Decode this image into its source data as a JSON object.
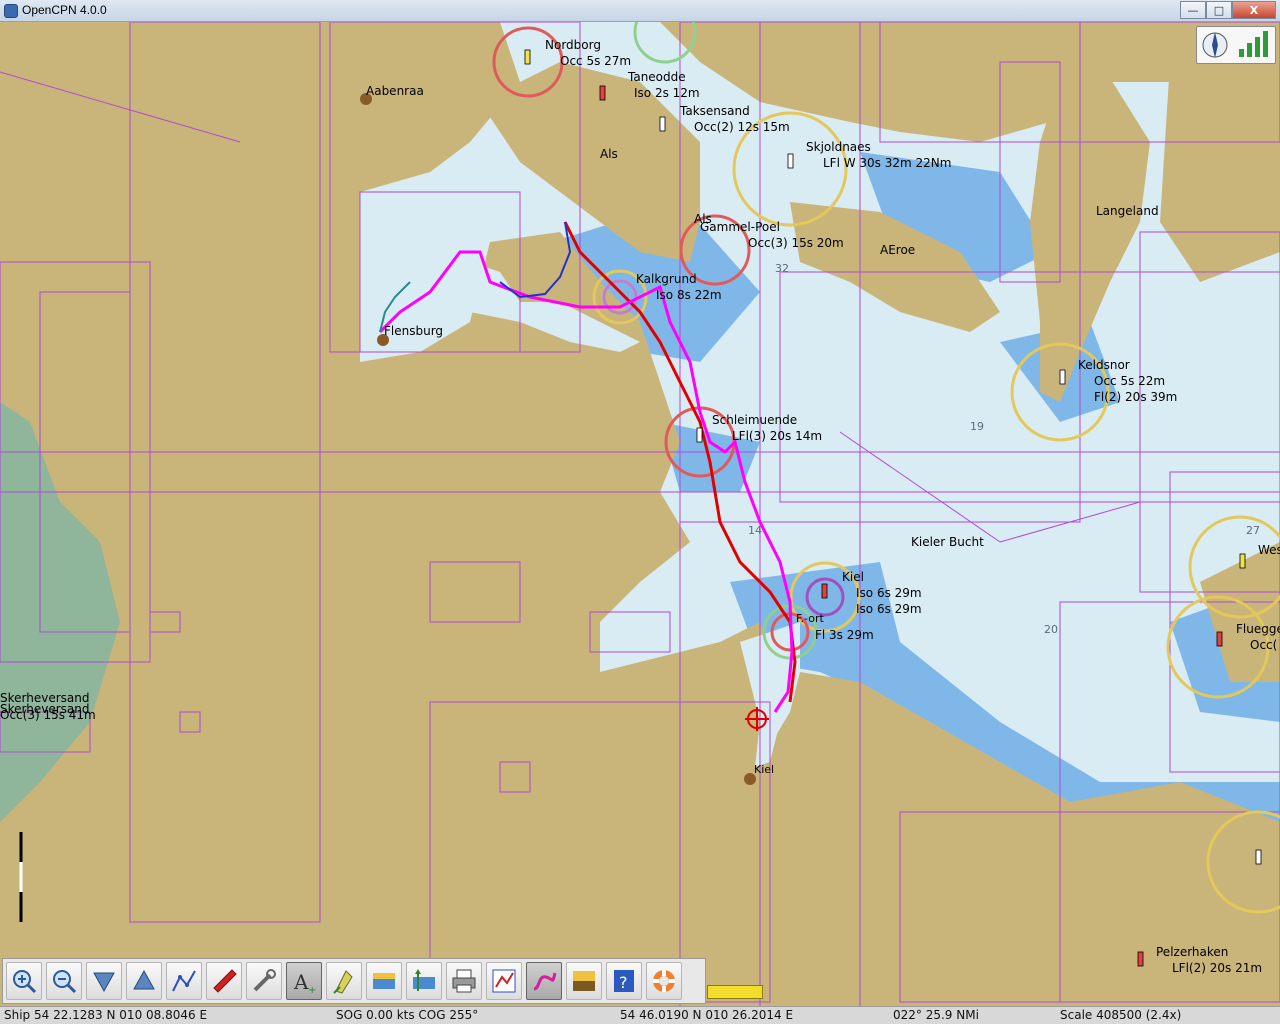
{
  "window": {
    "title": "OpenCPN 4.0.0",
    "min_label": "—",
    "max_label": "□",
    "close_label": "X"
  },
  "chart": {
    "places": [
      {
        "id": "aabenraa",
        "text": "Aabenraa"
      },
      {
        "id": "nordborg",
        "text": "Nordborg"
      },
      {
        "id": "nordborg_light",
        "text": "Occ 5s 27m"
      },
      {
        "id": "taneodde",
        "text": "Taneodde"
      },
      {
        "id": "taneodde_light",
        "text": "Iso 2s 12m"
      },
      {
        "id": "taksensand",
        "text": "Taksensand"
      },
      {
        "id": "taksensand_light",
        "text": "Occ(2) 12s 15m"
      },
      {
        "id": "als",
        "text": "Als"
      },
      {
        "id": "skjoldnaes",
        "text": "Skjoldnaes"
      },
      {
        "id": "skjoldnaes_light",
        "text": "LFl W 30s 32m 22Nm"
      },
      {
        "id": "langeland",
        "text": "Langeland"
      },
      {
        "id": "als2",
        "text": "Als"
      },
      {
        "id": "gammel_poel",
        "text": "Gammel-Poel"
      },
      {
        "id": "gammel_poel_light",
        "text": "Occ(3) 15s 20m"
      },
      {
        "id": "aeroe",
        "text": "AEroe"
      },
      {
        "id": "kalkgrund",
        "text": "Kalkgrund"
      },
      {
        "id": "kalkgrund_light",
        "text": "Iso 8s 22m"
      },
      {
        "id": "flensburg",
        "text": "Flensburg"
      },
      {
        "id": "keldsnor",
        "text": "Keldsnor"
      },
      {
        "id": "keldsnor_light1",
        "text": "Occ 5s 22m"
      },
      {
        "id": "keldsnor_light2",
        "text": "Fl(2) 20s 39m"
      },
      {
        "id": "schleimuende",
        "text": "Schleimuende"
      },
      {
        "id": "schleimuende_light",
        "text": "LFl(3) 20s 14m"
      },
      {
        "id": "kieler_bucht",
        "text": "Kieler Bucht"
      },
      {
        "id": "kiel_lh",
        "text": "Kiel"
      },
      {
        "id": "kiel_light1",
        "text": "Iso 6s 29m"
      },
      {
        "id": "kiel_light2",
        "text": "Iso 6s 29m"
      },
      {
        "id": "friedrichsort",
        "text": "F.-ort"
      },
      {
        "id": "friedrichsort_light",
        "text": "Fl 3s 29m"
      },
      {
        "id": "kiel_city",
        "text": "Kiel"
      },
      {
        "id": "flueggesand",
        "text": "Flueggesand"
      },
      {
        "id": "flueggesand_light",
        "text": "Occ("
      },
      {
        "id": "westermarkelsdorf",
        "text": "Wes"
      },
      {
        "id": "skerheversand",
        "text": "Skerheversand"
      },
      {
        "id": "skerheversand2",
        "text": "Skerheversand"
      },
      {
        "id": "skerheversand_light",
        "text": "Occ(3) 15s 41m"
      },
      {
        "id": "pelzerhaken",
        "text": "Pelzerhaken"
      },
      {
        "id": "pelzerhaken_light",
        "text": "LFl(2) 20s 21m"
      }
    ],
    "depths": [
      {
        "id": "d32",
        "text": "32"
      },
      {
        "id": "d19",
        "text": "19"
      },
      {
        "id": "d14",
        "text": "14"
      },
      {
        "id": "d20",
        "text": "20"
      },
      {
        "id": "d27",
        "text": "27"
      }
    ]
  },
  "toolbar": {
    "buttons": [
      {
        "name": "zoom-in",
        "icon": "zoom-in-icon"
      },
      {
        "name": "zoom-out",
        "icon": "zoom-out-icon"
      },
      {
        "name": "scale-down",
        "icon": "scale-down-icon"
      },
      {
        "name": "scale-up",
        "icon": "scale-up-icon"
      },
      {
        "name": "create-route",
        "icon": "route-icon"
      },
      {
        "name": "auto-follow",
        "icon": "ship-icon"
      },
      {
        "name": "settings",
        "icon": "wrench-icon"
      },
      {
        "name": "text",
        "icon": "text-icon"
      },
      {
        "name": "current-tide",
        "icon": "tide-icon"
      },
      {
        "name": "tide",
        "icon": "tide-station-icon"
      },
      {
        "name": "current",
        "icon": "current-icon"
      },
      {
        "name": "print",
        "icon": "print-icon"
      },
      {
        "name": "route-manager",
        "icon": "route-manager-icon"
      },
      {
        "name": "track",
        "icon": "track-icon"
      },
      {
        "name": "color-scheme",
        "icon": "color-scheme-icon"
      },
      {
        "name": "help",
        "icon": "help-icon"
      },
      {
        "name": "mob",
        "icon": "lifebuoy-icon"
      }
    ]
  },
  "statusbar": {
    "ship": "Ship 54 22.1283 N   010 08.8046 E",
    "sog_cog": "SOG 0.00 kts  COG 255°",
    "cursor": "54 46.0190 N   010 26.2014 E",
    "brg_dist": "022°  25.9 NMi",
    "scale": "Scale 408500 (2.4x)"
  },
  "colors": {
    "land": "#c9b47a",
    "shallow": "#7fb8e8",
    "deep": "#d9ebf3",
    "route": "#ff00ff",
    "track": "#e00000",
    "grid": "#b04ad6"
  }
}
